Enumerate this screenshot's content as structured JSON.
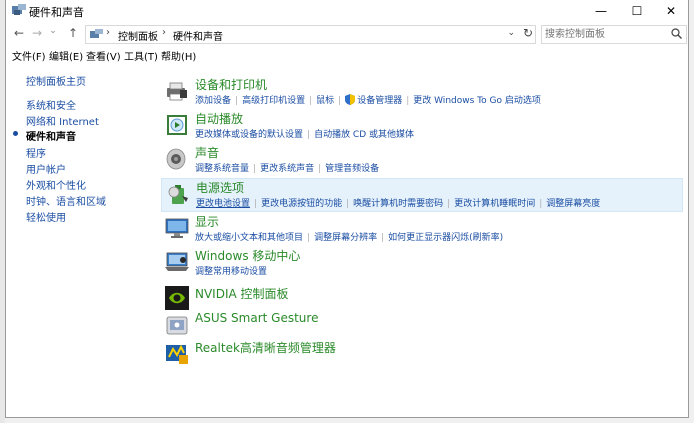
{
  "window": {
    "title": "硬件和声音",
    "minimize": "—",
    "maximize": "☐",
    "close": "✕"
  },
  "nav": {
    "back": "←",
    "forward": "→",
    "dropdown": "⌄",
    "up": "↑"
  },
  "address": {
    "crumbs": [
      "控制面板",
      "硬件和声音"
    ],
    "separator": "›",
    "dropdown": "⌄",
    "refresh": "↻"
  },
  "search": {
    "placeholder": "搜索控制面板"
  },
  "menu": [
    "文件(F)",
    "编辑(E)",
    "查看(V)",
    "工具(T)",
    "帮助(H)"
  ],
  "sidebar": {
    "items": [
      {
        "label": "控制面板主页"
      },
      {
        "label": "系统和安全"
      },
      {
        "label": "网络和 Internet"
      },
      {
        "label": "硬件和声音",
        "current": true
      },
      {
        "label": "程序"
      },
      {
        "label": "用户帐户"
      },
      {
        "label": "外观和个性化"
      },
      {
        "label": "时钟、语言和区域"
      },
      {
        "label": "轻松使用"
      }
    ]
  },
  "categories": [
    {
      "icon": "printer-icon",
      "title": "设备和打印机",
      "links": [
        "添加设备",
        "高级打印机设置",
        "鼠标",
        "设备管理器",
        "更改 Windows To Go 启动选项"
      ]
    },
    {
      "icon": "autoplay-icon",
      "title": "自动播放",
      "links": [
        "更改媒体或设备的默认设置",
        "自动播放 CD 或其他媒体"
      ]
    },
    {
      "icon": "speaker-icon",
      "title": "声音",
      "links": [
        "调整系统音量",
        "更改系统声音",
        "管理音频设备"
      ]
    },
    {
      "icon": "power-options-icon",
      "title": "电源选项",
      "highlighted": true,
      "links": [
        "更改电池设置",
        "更改电源按钮的功能",
        "唤醒计算机时需要密码",
        "更改计算机睡眠时间",
        "调整屏幕亮度"
      ]
    },
    {
      "icon": "display-icon",
      "title": "显示",
      "links": [
        "放大或缩小文本和其他项目",
        "调整屏幕分辨率",
        "如何更正显示器闪烁(刷新率)"
      ]
    },
    {
      "icon": "mobility-center-icon",
      "title": "Windows 移动中心",
      "links": [
        "调整常用移动设置"
      ]
    },
    {
      "icon": "nvidia-icon",
      "title": "NVIDIA 控制面板",
      "links": []
    },
    {
      "icon": "touchpad-icon",
      "title": "ASUS Smart Gesture",
      "links": []
    },
    {
      "icon": "realtek-icon",
      "title": "Realtek高清晰音频管理器",
      "links": []
    }
  ]
}
